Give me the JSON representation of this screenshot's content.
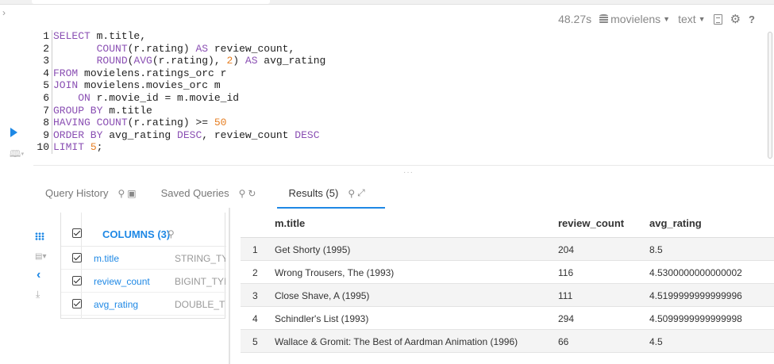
{
  "toolbar": {
    "exec_time": "48.27s",
    "database": "movielens",
    "format": "text"
  },
  "editor": {
    "line_numbers": [
      "1",
      "2",
      "3",
      "4",
      "5",
      "6",
      "7",
      "8",
      "9",
      "10"
    ],
    "lines": [
      [
        {
          "t": "kw",
          "v": "SELECT"
        },
        {
          "t": "plain",
          "v": " m.title,"
        }
      ],
      [
        {
          "t": "plain",
          "v": "       "
        },
        {
          "t": "kw",
          "v": "COUNT"
        },
        {
          "t": "plain",
          "v": "(r.rating) "
        },
        {
          "t": "kw",
          "v": "AS"
        },
        {
          "t": "plain",
          "v": " review_count,"
        }
      ],
      [
        {
          "t": "plain",
          "v": "       "
        },
        {
          "t": "kw",
          "v": "ROUND"
        },
        {
          "t": "plain",
          "v": "("
        },
        {
          "t": "kw",
          "v": "AVG"
        },
        {
          "t": "plain",
          "v": "(r.rating), "
        },
        {
          "t": "num",
          "v": "2"
        },
        {
          "t": "plain",
          "v": ") "
        },
        {
          "t": "kw",
          "v": "AS"
        },
        {
          "t": "plain",
          "v": " avg_rating"
        }
      ],
      [
        {
          "t": "kw",
          "v": "FROM"
        },
        {
          "t": "plain",
          "v": " movielens.ratings_orc r"
        }
      ],
      [
        {
          "t": "kw",
          "v": "JOIN"
        },
        {
          "t": "plain",
          "v": " movielens.movies_orc m"
        }
      ],
      [
        {
          "t": "plain",
          "v": "    "
        },
        {
          "t": "kw",
          "v": "ON"
        },
        {
          "t": "plain",
          "v": " r.movie_id = m.movie_id"
        }
      ],
      [
        {
          "t": "kw",
          "v": "GROUP BY"
        },
        {
          "t": "plain",
          "v": " m.title"
        }
      ],
      [
        {
          "t": "kw",
          "v": "HAVING"
        },
        {
          "t": "plain",
          "v": " "
        },
        {
          "t": "kw",
          "v": "COUNT"
        },
        {
          "t": "plain",
          "v": "(r.rating) >= "
        },
        {
          "t": "num",
          "v": "50"
        }
      ],
      [
        {
          "t": "kw",
          "v": "ORDER BY"
        },
        {
          "t": "plain",
          "v": " avg_rating "
        },
        {
          "t": "kw",
          "v": "DESC"
        },
        {
          "t": "plain",
          "v": ", review_count "
        },
        {
          "t": "kw",
          "v": "DESC"
        }
      ],
      [
        {
          "t": "kw",
          "v": "LIMIT"
        },
        {
          "t": "plain",
          "v": " "
        },
        {
          "t": "num",
          "v": "5"
        },
        {
          "t": "plain",
          "v": ";"
        }
      ]
    ]
  },
  "tabs": {
    "query_history": "Query History",
    "saved_queries": "Saved Queries",
    "results": "Results (5)"
  },
  "columns_panel": {
    "title": "COLUMNS (3)",
    "columns": [
      {
        "name": "m.title",
        "type": "STRING_TY"
      },
      {
        "name": "review_count",
        "type": "BIGINT_TYI"
      },
      {
        "name": "avg_rating",
        "type": "DOUBLE_TY"
      }
    ]
  },
  "results": {
    "headers": [
      "m.title",
      "review_count",
      "avg_rating"
    ],
    "rows": [
      {
        "idx": "1",
        "title": "Get Shorty (1995)",
        "review_count": "204",
        "avg_rating": "8.5"
      },
      {
        "idx": "2",
        "title": "Wrong Trousers, The (1993)",
        "review_count": "116",
        "avg_rating": "4.5300000000000002"
      },
      {
        "idx": "3",
        "title": "Close Shave, A (1995)",
        "review_count": "111",
        "avg_rating": "4.5199999999999996"
      },
      {
        "idx": "4",
        "title": "Schindler's List (1993)",
        "review_count": "294",
        "avg_rating": "4.5099999999999998"
      },
      {
        "idx": "5",
        "title": "Wallace & Gromit: The Best of Aardman Animation (1996)",
        "review_count": "66",
        "avg_rating": "4.5"
      }
    ]
  },
  "colors": {
    "accent": "#1e88e5",
    "keyword": "#8a4fb3",
    "number": "#e67e22"
  }
}
